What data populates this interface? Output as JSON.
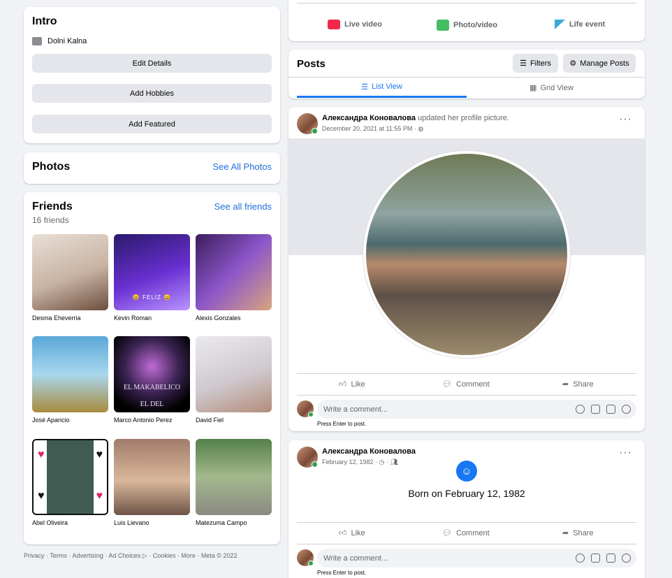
{
  "intro": {
    "title": "Intro",
    "location": "Dolni Kalna",
    "buttons": [
      "Edit Details",
      "Add Hobbies",
      "Add Featured"
    ]
  },
  "photos": {
    "title": "Photos",
    "see_all": "See All Photos"
  },
  "friends": {
    "title": "Friends",
    "count": "16 friends",
    "see_all": "See all friends",
    "list": [
      {
        "name": "Desma Eheverria"
      },
      {
        "name": "Kevin Roman",
        "overlay": "😄 FELIZ 😄"
      },
      {
        "name": "Alexis Gonzales"
      },
      {
        "name": "José Aparicio"
      },
      {
        "name": "Marco Antonio Perez",
        "overlay": "EL MAKABELICO",
        "overlay2": "EL DEL"
      },
      {
        "name": "David Fiel"
      },
      {
        "name": "Abel Oliveira"
      },
      {
        "name": "Luis Lievano"
      },
      {
        "name": "Matezuma Campo"
      }
    ]
  },
  "footer": "Privacy · Terms · Advertising · Ad Choices ▷ · Cookies · More · Meta © 2022",
  "composer": {
    "live": "Live video",
    "photo": "Photo/video",
    "life": "Life event"
  },
  "posts_header": {
    "title": "Posts",
    "filters": "Filters",
    "manage": "Manage Posts",
    "list_view": "List View",
    "grid_view": "Grid View"
  },
  "post1": {
    "author": "Александра Коновалова",
    "action": "updated her profile picture.",
    "date": "December 20, 2021 at 11:55 PM",
    "like": "Like",
    "comment": "Comment",
    "share": "Share",
    "comment_placeholder": "Write a comment...",
    "hint": "Press Enter to post."
  },
  "post2": {
    "author": "Александра Коновалова",
    "date": "February 12, 1982",
    "event": "Born on February 12, 1982",
    "like": "Like",
    "comment": "Comment",
    "share": "Share",
    "comment_placeholder": "Write a comment...",
    "hint": "Press Enter to post."
  }
}
